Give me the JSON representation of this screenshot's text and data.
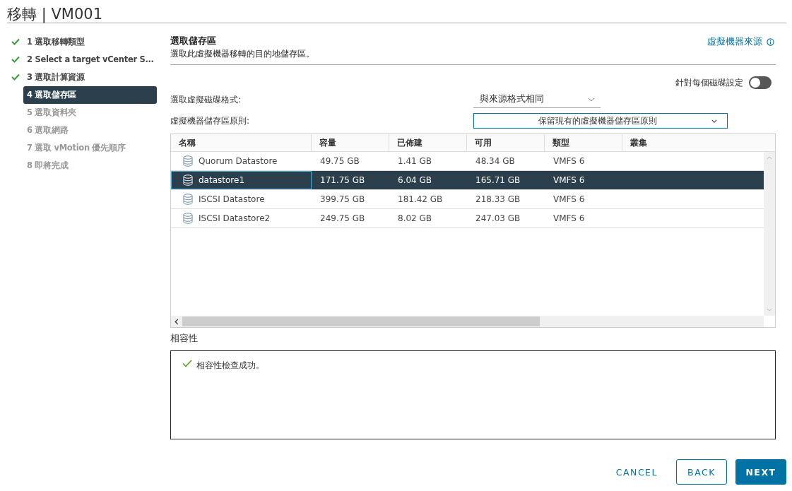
{
  "window": {
    "title": "移轉 | VM001"
  },
  "steps": [
    {
      "label": "1 選取移轉類型",
      "completed": true,
      "selected": false,
      "disabled": false
    },
    {
      "label": "2 Select a target vCenter S...",
      "completed": true,
      "selected": false,
      "disabled": false
    },
    {
      "label": "3 選取計算資源",
      "completed": true,
      "selected": false,
      "disabled": false
    },
    {
      "label": "4 選取儲存區",
      "completed": false,
      "selected": true,
      "disabled": false
    },
    {
      "label": "5 選取資料夾",
      "completed": false,
      "selected": false,
      "disabled": true
    },
    {
      "label": "6 選取網路",
      "completed": false,
      "selected": false,
      "disabled": true
    },
    {
      "label": "7 選取 vMotion 優先順序",
      "completed": false,
      "selected": false,
      "disabled": true
    },
    {
      "label": "8 即將完成",
      "completed": false,
      "selected": false,
      "disabled": true
    }
  ],
  "header": {
    "title": "選取儲存區",
    "subtitle": "選取此虛擬機器移轉的目的地儲存區。",
    "link": "虛擬機器來源"
  },
  "per_disk_toggle": {
    "label": "針對每個磁碟設定",
    "on": false
  },
  "disk_format": {
    "label": "選取虛擬磁碟格式:",
    "value": "與來源格式相同"
  },
  "storage_policy": {
    "label": "虛擬機器儲存區原則:",
    "value": "保留現有的虛擬機器儲存區原則"
  },
  "table": {
    "columns": [
      "名稱",
      "容量",
      "已佈建",
      "可用",
      "類型",
      "叢集"
    ],
    "rows": [
      {
        "cells": [
          "Quorum Datastore",
          "49.75 GB",
          "1.41 GB",
          "48.34 GB",
          "VMFS 6",
          ""
        ],
        "selected": false
      },
      {
        "cells": [
          "datastore1",
          "171.75 GB",
          "6.04 GB",
          "165.71 GB",
          "VMFS 6",
          ""
        ],
        "selected": true
      },
      {
        "cells": [
          "ISCSI Datastore",
          "399.75 GB",
          "181.42 GB",
          "218.33 GB",
          "VMFS 6",
          ""
        ],
        "selected": false
      },
      {
        "cells": [
          "ISCSI Datastore2",
          "249.75 GB",
          "8.02 GB",
          "247.03 GB",
          "VMFS 6",
          ""
        ],
        "selected": false
      }
    ]
  },
  "compatibility": {
    "label": "相容性",
    "message": "相容性檢查成功。"
  },
  "buttons": {
    "cancel": "CANCEL",
    "back": "BACK",
    "next": "NEXT"
  }
}
